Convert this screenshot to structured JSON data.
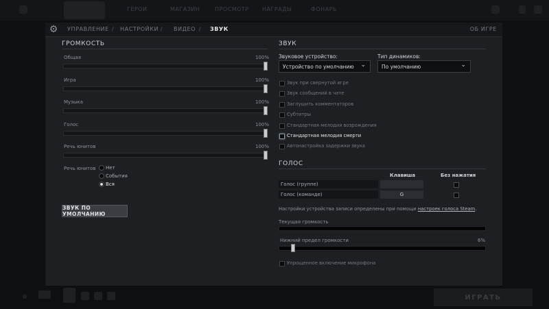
{
  "nav": {
    "items": [
      "УПРАВЛЕНИЕ",
      "НАСТРОЙКИ",
      "ВИДЕО",
      "ЗВУК"
    ],
    "separator": "/",
    "about": "ОБ ИГРЕ"
  },
  "volume": {
    "title": "ГРОМКОСТЬ",
    "sliders": [
      {
        "label": "Общая",
        "percent": "100%",
        "value": 1.0
      },
      {
        "label": "Игра",
        "percent": "100%",
        "value": 1.0
      },
      {
        "label": "Музыка",
        "percent": "100%",
        "value": 1.0
      },
      {
        "label": "Голос",
        "percent": "100%",
        "value": 1.0
      },
      {
        "label": "Речь юнитов",
        "percent": "100%",
        "value": 1.0
      }
    ],
    "unit_speech": {
      "label": "Речь юнитов",
      "options": [
        "Нет",
        "События",
        "Вся"
      ],
      "selected": "Вся"
    },
    "default_button": "ЗВУК ПО УМОЛЧАНИЮ"
  },
  "sound": {
    "title": "ЗВУК",
    "device_label": "Звуковое устройство:",
    "device_value": "Устройство по умолчанию",
    "speakers_label": "Тип динамиков:",
    "speakers_value": "По умолчанию",
    "options": [
      {
        "label": "Звук при свернутой игре",
        "checked": false,
        "highlighted": false
      },
      {
        "label": "Звук сообщений в чате",
        "checked": false,
        "highlighted": false
      },
      {
        "label": "Заглушить комментаторов",
        "checked": false,
        "highlighted": false
      },
      {
        "label": "Субтитры",
        "checked": false,
        "highlighted": false
      },
      {
        "label": "Стандартная мелодия возрождения",
        "checked": false,
        "highlighted": false
      },
      {
        "label": "Стандартная мелодия смерти",
        "checked": false,
        "highlighted": true
      },
      {
        "label": "Автонастройка задержки звука",
        "checked": false,
        "highlighted": false
      }
    ]
  },
  "voice": {
    "title": "ГОЛОС",
    "col_key": "Клавиша",
    "col_no_press": "Без нажатия",
    "rows": [
      {
        "label": "Голос (группе)",
        "key": ""
      },
      {
        "label": "Голос (команде)",
        "key": "G"
      }
    ],
    "note_prefix": "Настройки устройства записи определены при помощи ",
    "note_link": "настроек голоса Steam",
    "note_suffix": ".",
    "current_volume_label": "Текущая громкость",
    "lower_limit_label": "Нижний предел громкости",
    "lower_limit_percent": "6%",
    "lower_limit_value": 0.06,
    "simplified_mic": "Упрощенное включение микрофона"
  },
  "bottom": {
    "play_label": "ИГРАТЬ"
  },
  "top_bar": {
    "items": [
      "ГЕРОИ",
      "МАГАЗИН",
      "ПРОСМОТР",
      "НАГРАДЫ",
      "ФОНАРЬ"
    ]
  }
}
